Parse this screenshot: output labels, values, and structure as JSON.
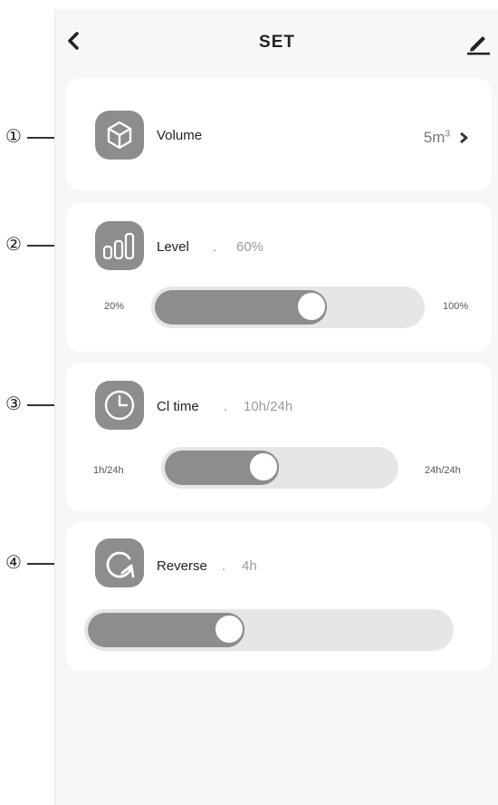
{
  "header": {
    "title": "SET"
  },
  "volume": {
    "label": "Volume",
    "value": "5m",
    "sup": "3"
  },
  "level": {
    "label": "Level",
    "sep": ".",
    "value": "60%",
    "min": "20%",
    "max": "100%",
    "position": 0.6
  },
  "cltime": {
    "label": "Cl time",
    "sep": ".",
    "value": "10h/24h",
    "min": "1h/24h",
    "max": "24h/24h",
    "position": 0.42
  },
  "reverse": {
    "label": "Reverse",
    "sep": ".",
    "value": "4h",
    "position": 0.38
  },
  "callouts": [
    "①",
    "②",
    "③",
    "④"
  ],
  "colors": {
    "accent_gray": "#8d8d8d",
    "track": "#e6e6e6",
    "background": "#f7f7f7"
  },
  "icons": [
    "back-chevron-icon",
    "edit-pen-icon",
    "cube-icon",
    "bar-level-icon",
    "clock-icon",
    "reverse-arrow-icon",
    "chevron-right-icon"
  ]
}
